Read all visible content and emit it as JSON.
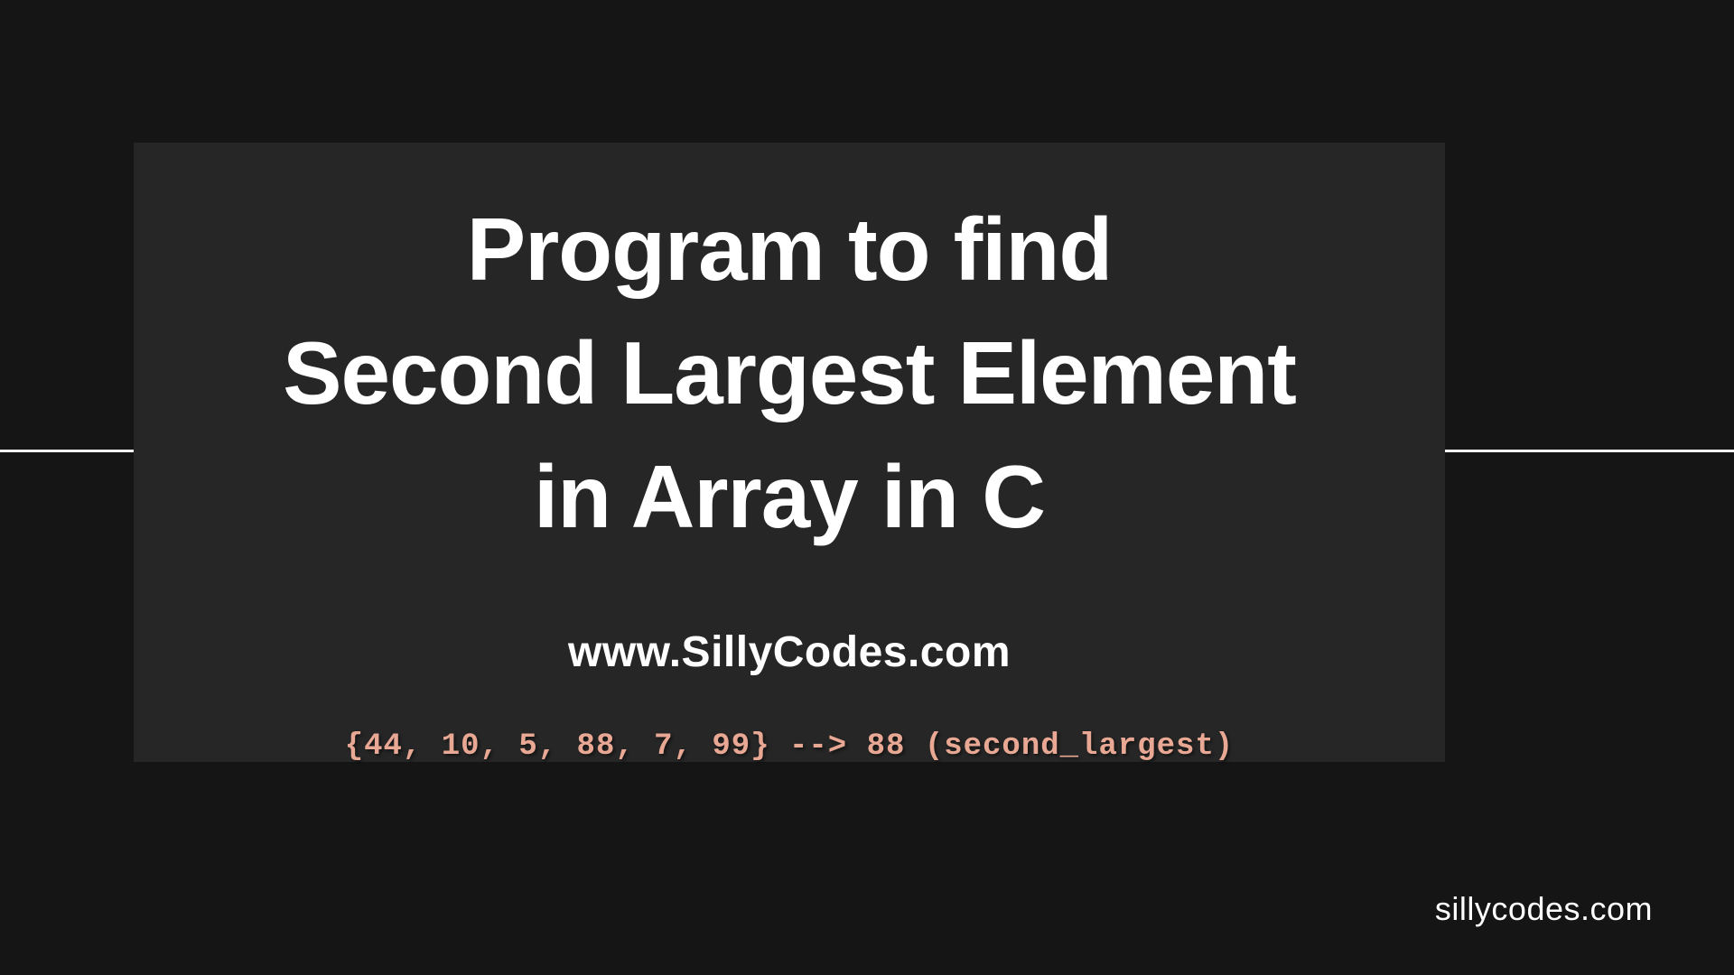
{
  "card": {
    "title_line1": "Program to find",
    "title_line2": "Second Largest Element",
    "title_line3": "in Array in C",
    "subtitle": "www.SillyCodes.com",
    "code_example": "{44, 10, 5, 88, 7, 99}  --> 88 (second_largest)"
  },
  "footer": {
    "text": "sillycodes.com"
  }
}
